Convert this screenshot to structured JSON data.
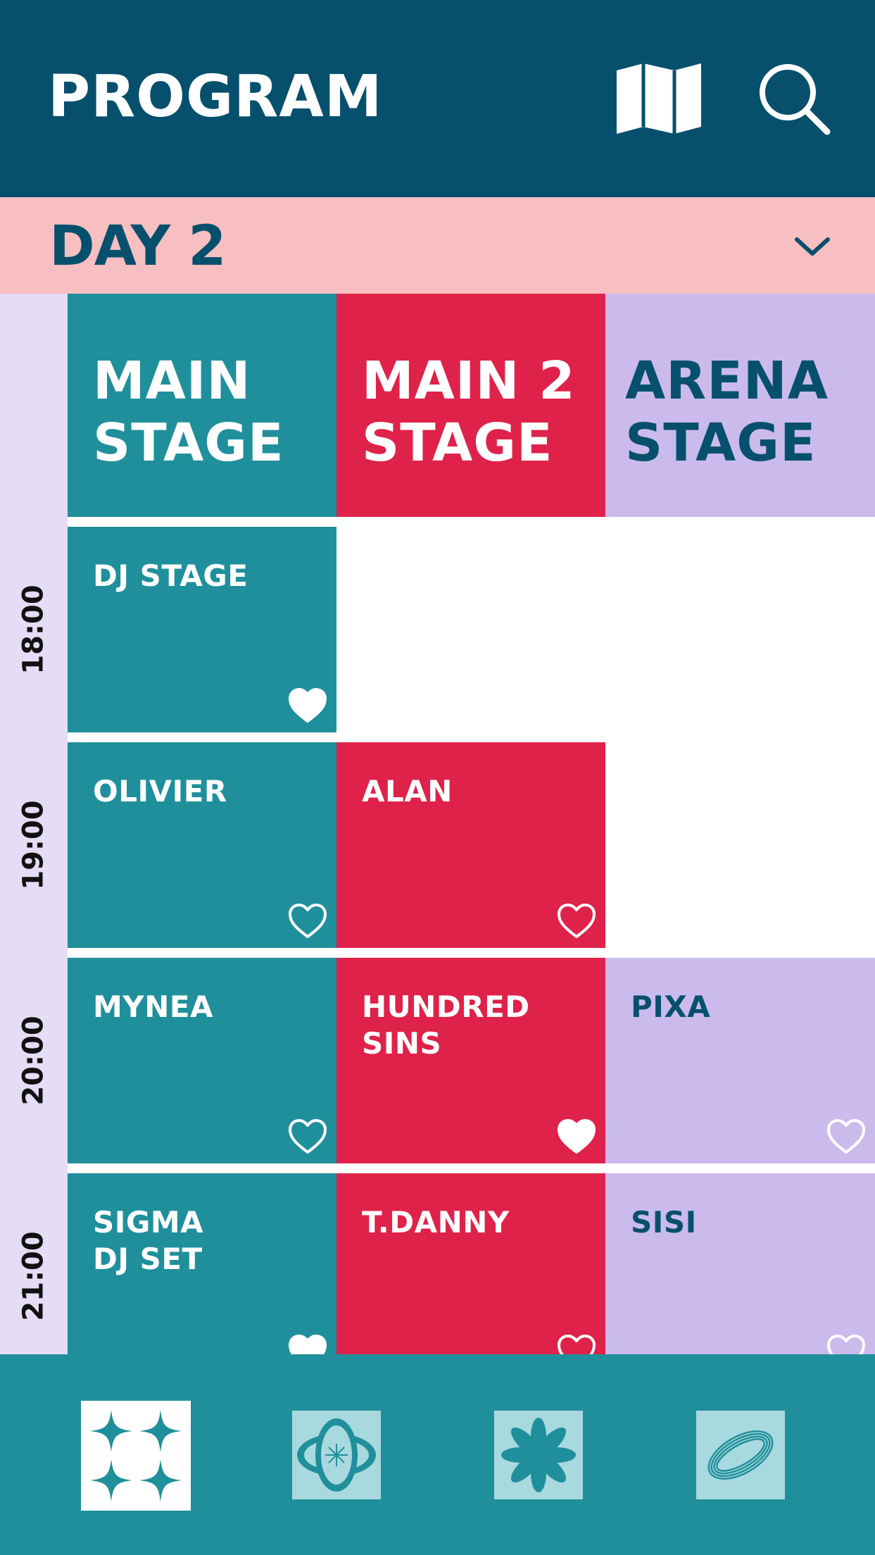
{
  "header": {
    "title": "PROGRAM",
    "map_icon": "map-icon",
    "search_icon": "search-icon"
  },
  "day_selector": {
    "label": "DAY 2",
    "icon": "chevron-down-icon"
  },
  "stages": [
    {
      "line1": "MAIN",
      "line2": "STAGE"
    },
    {
      "line1": "MAIN 2",
      "line2": "STAGE"
    },
    {
      "line1": "ARENA",
      "line2": "STAGE"
    }
  ],
  "times": [
    "18:00",
    "19:00",
    "20:00",
    "21:00"
  ],
  "schedule": {
    "t1800": {
      "main": {
        "name": "DJ STAGE",
        "favorited": true
      }
    },
    "t1900": {
      "main": {
        "name": "OLIVIER",
        "favorited": false
      },
      "main2": {
        "name": "ALAN",
        "favorited": false
      }
    },
    "t2000": {
      "main": {
        "name": "MYNEA",
        "favorited": false
      },
      "main2": {
        "name": "HUNDRED\nSINS",
        "favorited": true
      },
      "arena": {
        "name": "PIXA",
        "favorited": false
      }
    },
    "t2100": {
      "main": {
        "name": "SIGMA\nDJ SET",
        "favorited": true
      },
      "main2": {
        "name": "T.DANNY",
        "favorited": false
      },
      "arena": {
        "name": "SISI",
        "favorited": false
      }
    }
  },
  "bottom_nav": [
    {
      "icon": "four-point-star-icon",
      "active": true
    },
    {
      "icon": "orbit-planet-icon",
      "active": false
    },
    {
      "icon": "flower-icon",
      "active": false
    },
    {
      "icon": "rings-icon",
      "active": false
    }
  ],
  "colors": {
    "header": "#06506d",
    "day_bar": "#f7bfc1",
    "main_stage": "#208f9c",
    "main2_stage": "#df2249",
    "arena_stage": "#cbbbec",
    "time_column": "#e5dcf5"
  }
}
